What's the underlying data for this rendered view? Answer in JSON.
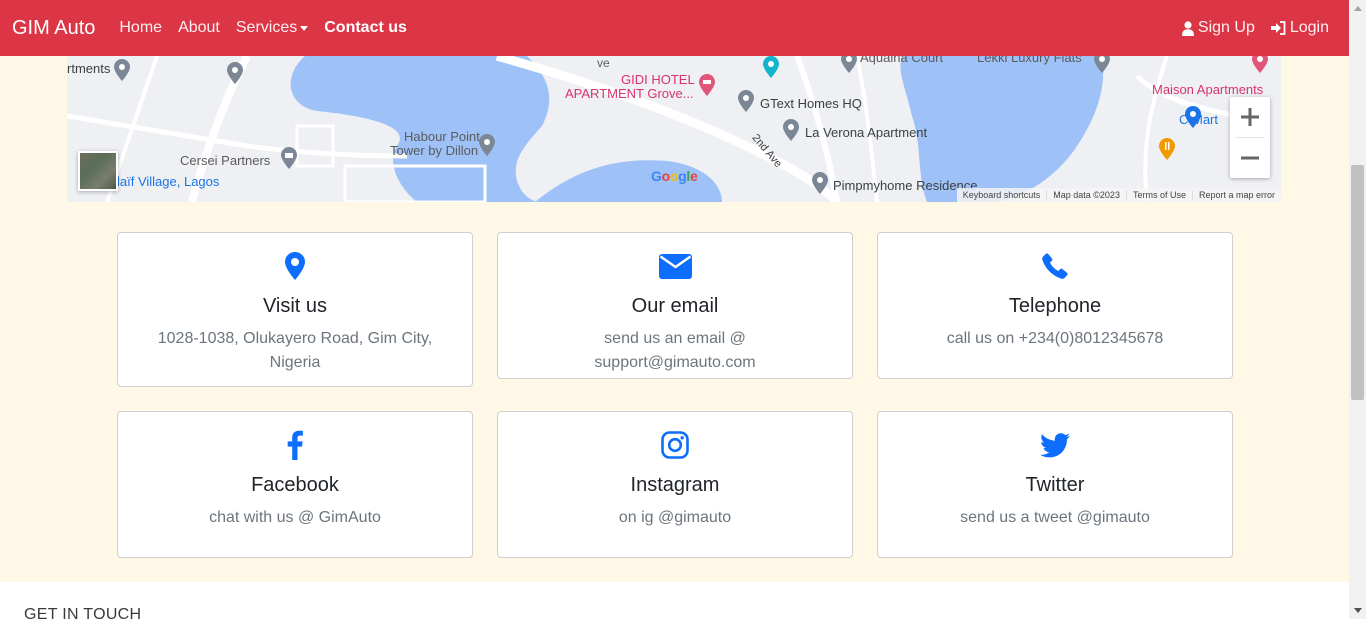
{
  "navbar": {
    "brand": "GIM Auto",
    "links": [
      "Home",
      "About",
      "Services",
      "Contact us"
    ],
    "right": [
      "Sign Up",
      "Login"
    ]
  },
  "map": {
    "labels": {
      "l1": "rtments",
      "l2": "GIDI HOTEL",
      "l3": "APARTMENT Grove...",
      "l4": "GText Homes HQ",
      "l5": "La Verona Apartment",
      "l6": "Aquaina Court",
      "l7": "Lekki Luxury Flats",
      "l8": "Maison Apartments",
      "l9": "C Mart",
      "l10": "Habour Point",
      "l11": "Tower by Dillon",
      "l12": "Cersei Partners",
      "l13": "laïf Village, Lagos",
      "l14": "2nd Ave",
      "l15": "Pimpmyhome Residence",
      "l16": "ve"
    },
    "google": "Google",
    "footer": [
      "Keyboard shortcuts",
      "Map data ©2023",
      "Terms of Use",
      "Report a map error"
    ]
  },
  "cards": [
    {
      "title": "Visit us",
      "text": "1028-1038, Olukayero Road, Gim City, Nigeria",
      "icon": "location-pin-icon"
    },
    {
      "title": "Our email",
      "text": "send us an email @ support@gimauto.com",
      "icon": "envelope-icon"
    },
    {
      "title": "Telephone",
      "text": "call us on +234(0)8012345678",
      "icon": "phone-icon"
    },
    {
      "title": "Facebook",
      "text": "chat with us @ GimAuto",
      "icon": "facebook-icon"
    },
    {
      "title": "Instagram",
      "text": "on ig @gimauto",
      "icon": "instagram-icon"
    },
    {
      "title": "Twitter",
      "text": "send us a tweet @gimauto",
      "icon": "twitter-icon"
    }
  ],
  "get_in_touch": "GET IN TOUCH",
  "colors": {
    "navbar": "#dc3545",
    "section_bg": "#fff8e7",
    "icon": "#0d6efd",
    "water": "#9ec1f8"
  }
}
